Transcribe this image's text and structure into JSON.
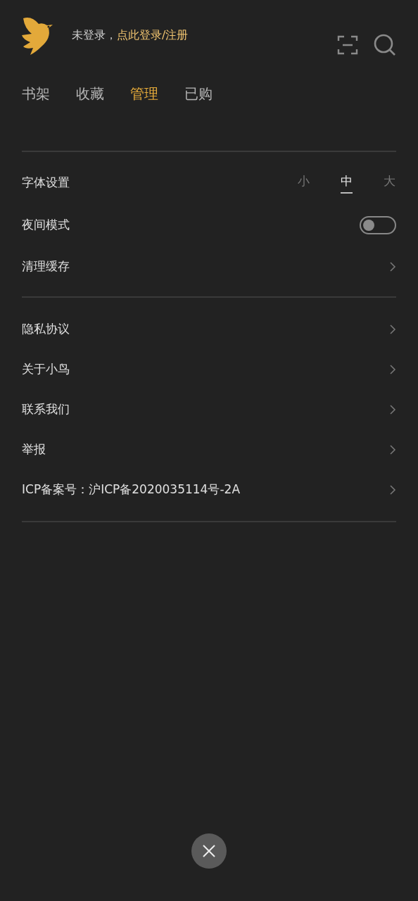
{
  "header": {
    "status": "未登录，",
    "login_link": "点此登录/注册"
  },
  "tabs": [
    {
      "label": "书架",
      "selected": false
    },
    {
      "label": "收藏",
      "selected": false
    },
    {
      "label": "管理",
      "selected": true
    },
    {
      "label": "已购",
      "selected": false
    }
  ],
  "settings": [
    {
      "kind": "font_size",
      "label": "字体设置",
      "options": [
        {
          "label": "小",
          "selected": false
        },
        {
          "label": "中",
          "selected": true
        },
        {
          "label": "大",
          "selected": false
        }
      ]
    },
    {
      "kind": "toggle",
      "label": "夜间模式",
      "on": false
    },
    {
      "kind": "link",
      "label": "清理缓存"
    }
  ],
  "links": [
    {
      "label": "隐私协议"
    },
    {
      "label": "关于小鸟"
    },
    {
      "label": "联系我们"
    },
    {
      "label": "举报"
    },
    {
      "label": "ICP备案号：沪ICP备2020035114号-2A"
    }
  ]
}
